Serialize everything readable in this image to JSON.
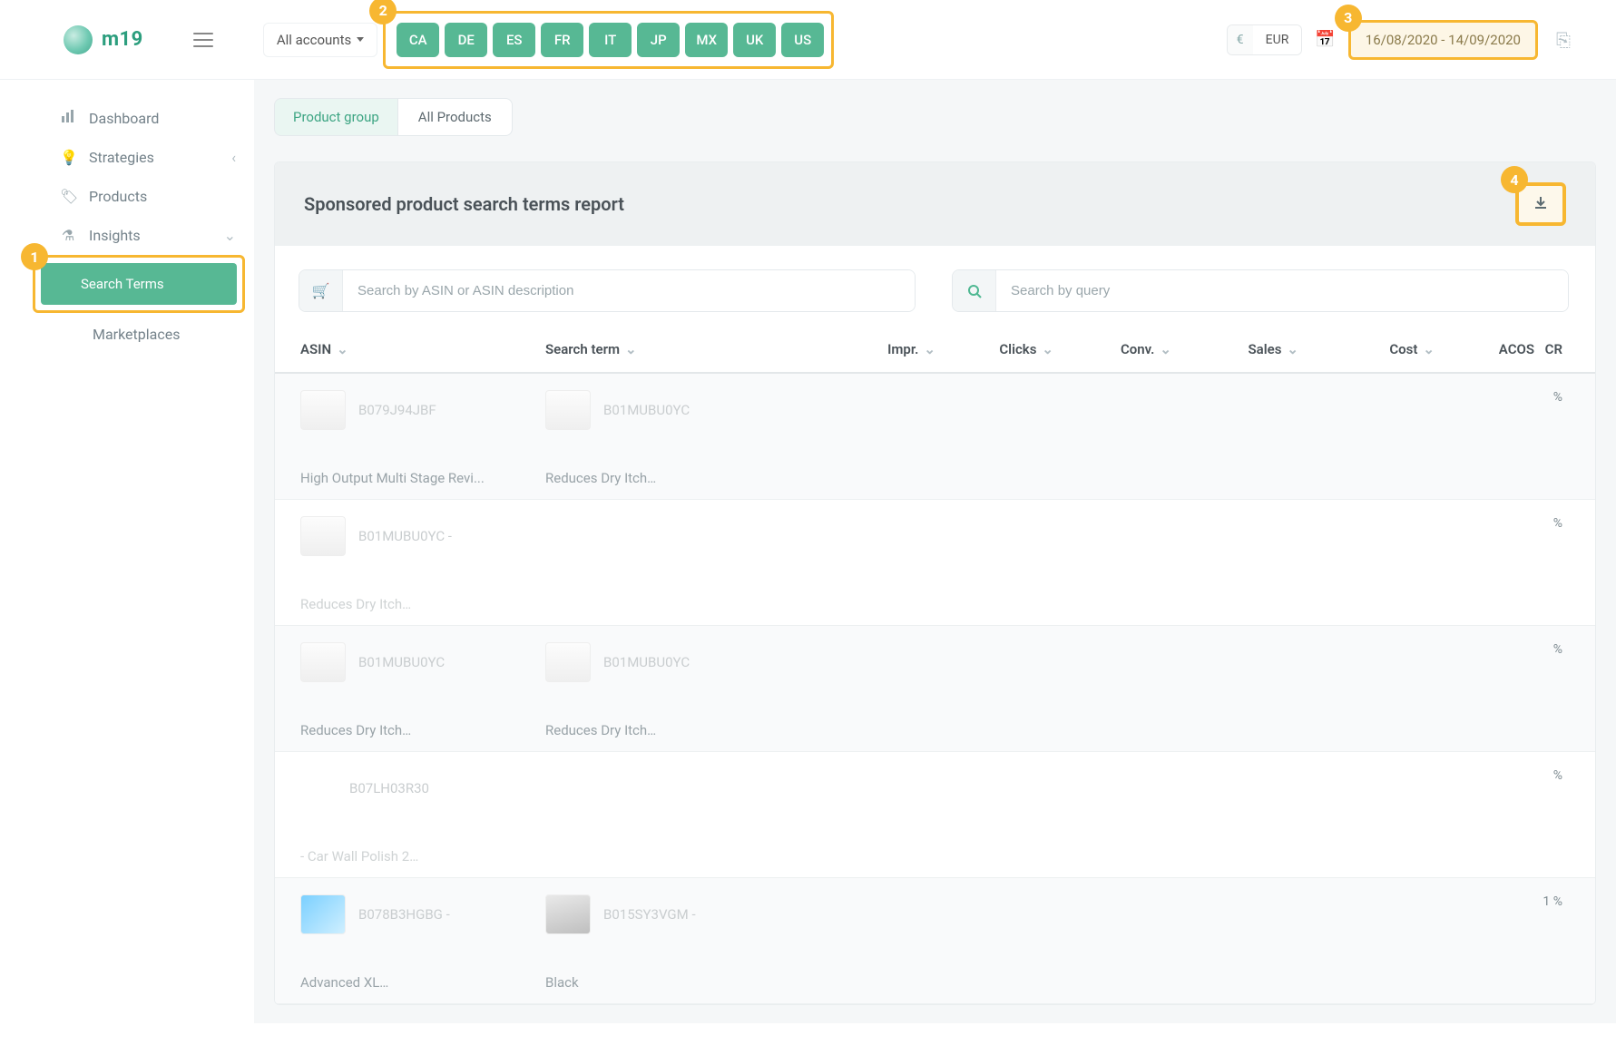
{
  "app": {
    "name": "m19"
  },
  "header": {
    "accounts_label": "All accounts",
    "markets": [
      "CA",
      "DE",
      "ES",
      "FR",
      "IT",
      "JP",
      "MX",
      "UK",
      "US"
    ],
    "currency_symbol": "€",
    "currency_code": "EUR",
    "date_range": "16/08/2020 - 14/09/2020"
  },
  "annotations": {
    "a1": "1",
    "a2": "2",
    "a3": "3",
    "a4": "4"
  },
  "sidebar": {
    "items": [
      {
        "label": "Dashboard"
      },
      {
        "label": "Strategies"
      },
      {
        "label": "Products"
      },
      {
        "label": "Insights"
      }
    ],
    "sub_active": "Search Terms",
    "sub_other": "Marketplaces"
  },
  "product_group": {
    "label": "Product group",
    "value": "All Products"
  },
  "report": {
    "title": "Sponsored product search terms report",
    "search_asin_placeholder": "Search by ASIN or ASIN description",
    "search_query_placeholder": "Search by query",
    "columns": {
      "asin": "ASIN",
      "term": "Search term",
      "impr": "Impr.",
      "clicks": "Clicks",
      "conv": "Conv.",
      "sales": "Sales",
      "cost": "Cost",
      "acos": "ACOS",
      "cr": "CR"
    },
    "rows": [
      {
        "asin_code": "B079J94JBF",
        "asin_desc": "High Output Multi Stage Revi...",
        "term_code": "B01MUBU0YC",
        "term_desc": "Reduces Dry Itch…",
        "cr": "%"
      },
      {
        "asin_code": "B01MUBU0YC -",
        "asin_desc": "Reduces Dry Itch…",
        "term_code": "",
        "term_desc": "",
        "cr": "%"
      },
      {
        "asin_code": "B01MUBU0YC",
        "asin_desc": "Reduces Dry Itch…",
        "term_code": "B01MUBU0YC",
        "term_desc": "Reduces Dry Itch…",
        "cr": "%"
      },
      {
        "asin_code": "B07LH03R30",
        "asin_desc": "- Car Wall Polish 2…",
        "term_code": "",
        "term_desc": "",
        "cr": "%"
      },
      {
        "asin_code": "B078B3HGBG -",
        "asin_desc": "Advanced XL…",
        "term_code": "B015SY3VGM -",
        "term_desc": "Black",
        "cr": "1 %"
      }
    ]
  }
}
